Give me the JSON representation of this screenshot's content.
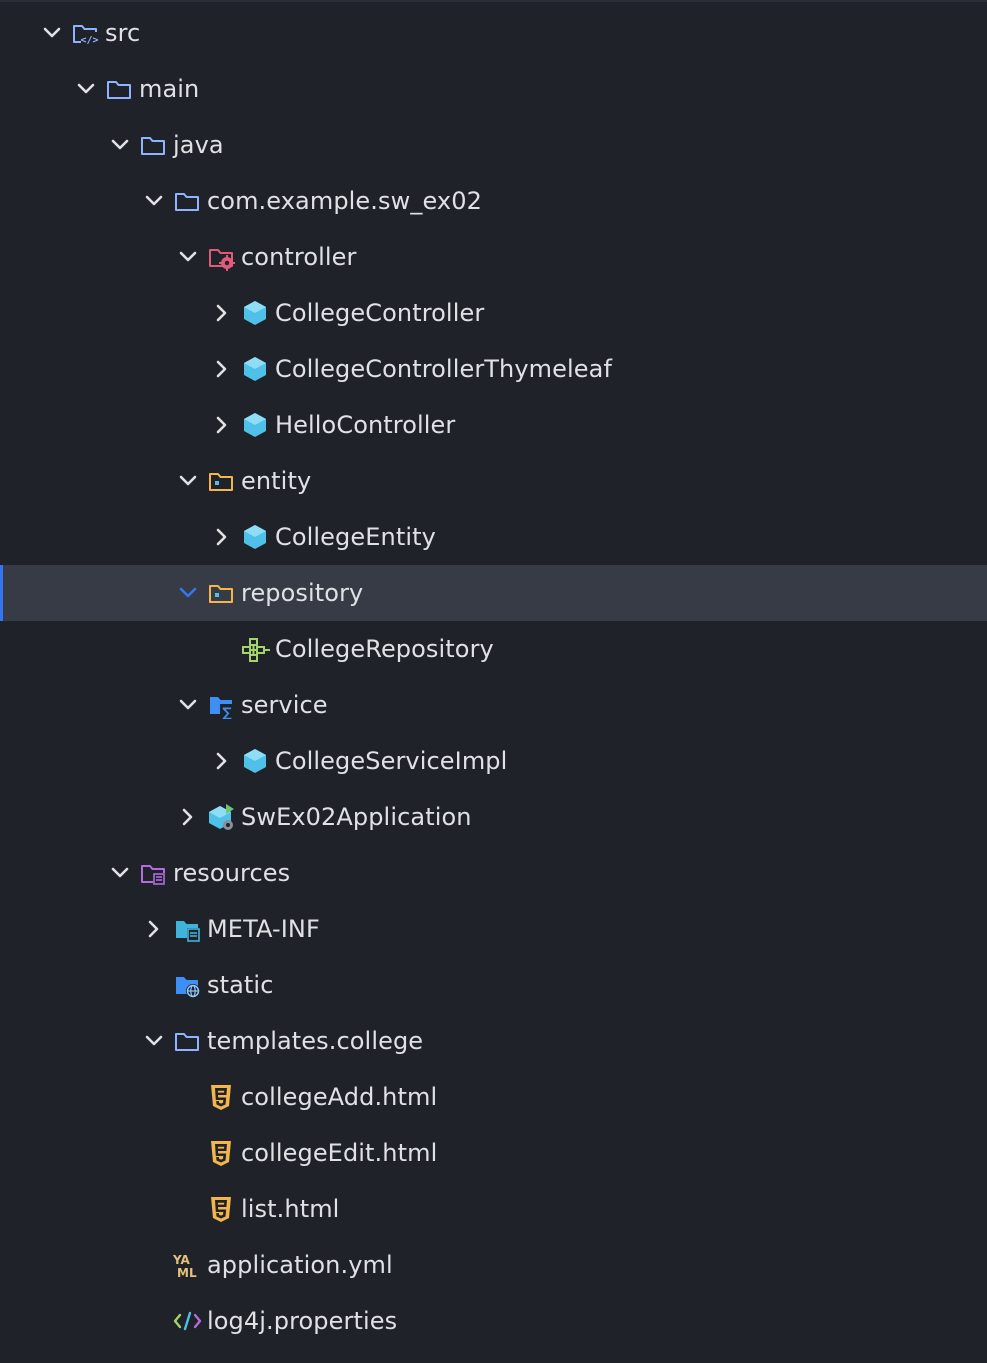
{
  "colors": {
    "background": "#1f2229",
    "selected_row": "#373b45",
    "selection_accent": "#3574f0",
    "text": "#dfe1e5",
    "folder_outline": "#8fb3ff",
    "class_icon": "#4fc1e9",
    "html_icon": "#f2b64c",
    "controller_folder": "#e05a7a",
    "resources_folder": "#b46be0",
    "service_folder": "#3d8ef5",
    "interface_icon": "#a4d36a",
    "yaml_icon": "#e5c07b"
  },
  "tree": [
    {
      "label": "src",
      "depth": 0,
      "chevron": "down",
      "icon": "source-folder-icon"
    },
    {
      "label": "main",
      "depth": 1,
      "chevron": "down",
      "icon": "folder-icon"
    },
    {
      "label": "java",
      "depth": 2,
      "chevron": "down",
      "icon": "folder-icon"
    },
    {
      "label": "com.example.sw_ex02",
      "depth": 3,
      "chevron": "down",
      "icon": "folder-icon"
    },
    {
      "label": "controller",
      "depth": 4,
      "chevron": "down",
      "icon": "controller-folder-icon"
    },
    {
      "label": "CollegeController",
      "depth": 5,
      "chevron": "right",
      "icon": "class-icon"
    },
    {
      "label": "CollegeControllerThymeleaf",
      "depth": 5,
      "chevron": "right",
      "icon": "class-icon"
    },
    {
      "label": "HelloController",
      "depth": 5,
      "chevron": "right",
      "icon": "class-icon"
    },
    {
      "label": "entity",
      "depth": 4,
      "chevron": "down",
      "icon": "entity-folder-icon"
    },
    {
      "label": "CollegeEntity",
      "depth": 5,
      "chevron": "right",
      "icon": "class-icon"
    },
    {
      "label": "repository",
      "depth": 4,
      "chevron": "down",
      "icon": "repository-folder-icon",
      "selected": true
    },
    {
      "label": "CollegeRepository",
      "depth": 5,
      "chevron": "none",
      "icon": "interface-icon"
    },
    {
      "label": "service",
      "depth": 4,
      "chevron": "down",
      "icon": "service-folder-icon"
    },
    {
      "label": "CollegeServiceImpl",
      "depth": 5,
      "chevron": "right",
      "icon": "class-icon"
    },
    {
      "label": "SwEx02Application",
      "depth": 4,
      "chevron": "right",
      "icon": "application-class-icon"
    },
    {
      "label": "resources",
      "depth": 2,
      "chevron": "down",
      "icon": "resources-folder-icon"
    },
    {
      "label": "META-INF",
      "depth": 3,
      "chevron": "right",
      "icon": "meta-folder-icon"
    },
    {
      "label": "static",
      "depth": 3,
      "chevron": "none",
      "icon": "web-folder-icon"
    },
    {
      "label": "templates.college",
      "depth": 3,
      "chevron": "down",
      "icon": "folder-icon"
    },
    {
      "label": "collegeAdd.html",
      "depth": 4,
      "chevron": "none",
      "icon": "html-icon"
    },
    {
      "label": "collegeEdit.html",
      "depth": 4,
      "chevron": "none",
      "icon": "html-icon"
    },
    {
      "label": "list.html",
      "depth": 4,
      "chevron": "none",
      "icon": "html-icon"
    },
    {
      "label": "application.yml",
      "depth": 3,
      "chevron": "none",
      "icon": "yaml-icon"
    },
    {
      "label": "log4j.properties",
      "depth": 3,
      "chevron": "none",
      "icon": "properties-icon"
    }
  ]
}
